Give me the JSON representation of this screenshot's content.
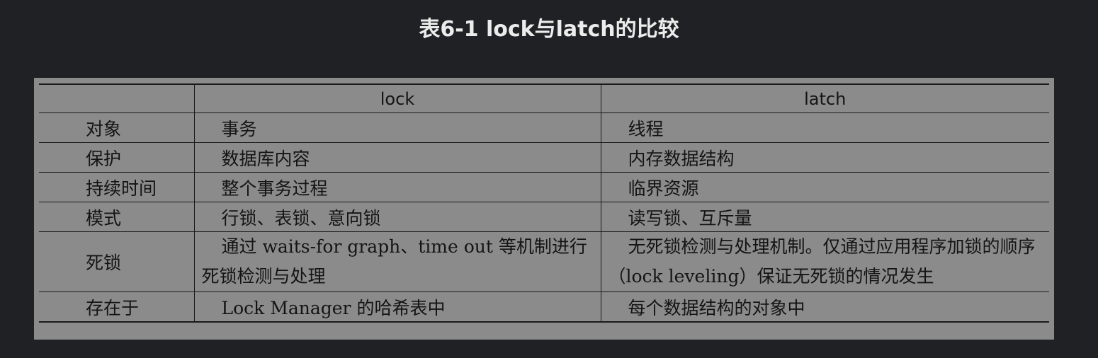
{
  "caption": "表6-1 lock与latch的比较",
  "table": {
    "headers": [
      "",
      "lock",
      "latch"
    ],
    "rows": [
      {
        "attribute": "对象",
        "lock": "事务",
        "latch": "线程"
      },
      {
        "attribute": "保护",
        "lock": "数据库内容",
        "latch": "内存数据结构"
      },
      {
        "attribute": "持续时间",
        "lock": "整个事务过程",
        "latch": "临界资源"
      },
      {
        "attribute": "模式",
        "lock": "行锁、表锁、意向锁",
        "latch": "读写锁、互斥量"
      },
      {
        "attribute": "死锁",
        "lock": "通过 waits-for graph、time out 等机制进行死锁检测与处理",
        "latch": "无死锁检测与处理机制。仅通过应用程序加锁的顺序（lock leveling）保证无死锁的情况发生"
      },
      {
        "attribute": "存在于",
        "lock": "Lock Manager 的哈希表中",
        "latch": "每个数据结构的对象中"
      }
    ]
  }
}
